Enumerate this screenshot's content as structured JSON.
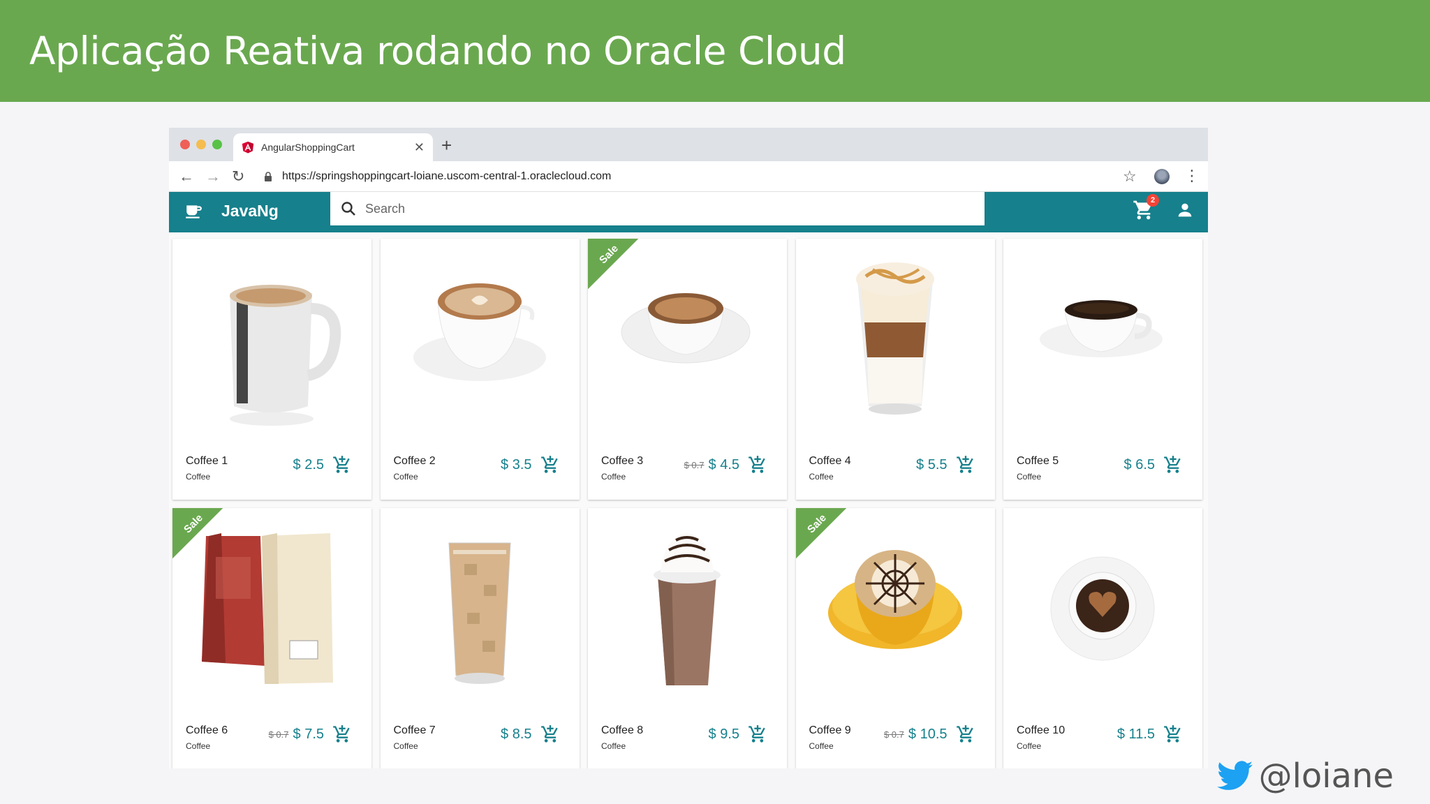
{
  "slide": {
    "title": "Aplicação Reativa rodando no Oracle Cloud",
    "twitter_handle": "@loiane"
  },
  "browser": {
    "tab_title": "AngularShoppingCart",
    "url": "https://springshoppingcart-loiane.uscom-central-1.oraclecloud.com"
  },
  "app": {
    "name": "JavaNg",
    "search_placeholder": "Search",
    "cart_count": "2",
    "accent_color": "#16808c",
    "sale_color": "#6aa84f"
  },
  "products": [
    {
      "name": "Coffee 1",
      "category": "Coffee",
      "old_price": "",
      "price": "$ 2.5",
      "sale": false,
      "image": "mug"
    },
    {
      "name": "Coffee 2",
      "category": "Coffee",
      "old_price": "",
      "price": "$ 3.5",
      "sale": false,
      "image": "latte-art-cup"
    },
    {
      "name": "Coffee 3",
      "category": "Coffee",
      "old_price": "$ 0.7",
      "price": "$ 4.5",
      "sale": true,
      "image": "espresso-cup"
    },
    {
      "name": "Coffee 4",
      "category": "Coffee",
      "old_price": "",
      "price": "$ 5.5",
      "sale": false,
      "image": "caramel-macchiato"
    },
    {
      "name": "Coffee 5",
      "category": "Coffee",
      "old_price": "",
      "price": "$ 6.5",
      "sale": false,
      "image": "black-coffee-cup"
    },
    {
      "name": "Coffee 6",
      "category": "Coffee",
      "old_price": "$ 0.7",
      "price": "$ 7.5",
      "sale": true,
      "image": "coffee-bags"
    },
    {
      "name": "Coffee 7",
      "category": "Coffee",
      "old_price": "",
      "price": "$ 8.5",
      "sale": false,
      "image": "iced-coffee"
    },
    {
      "name": "Coffee 8",
      "category": "Coffee",
      "old_price": "",
      "price": "$ 9.5",
      "sale": false,
      "image": "frappuccino"
    },
    {
      "name": "Coffee 9",
      "category": "Coffee",
      "old_price": "$ 0.7",
      "price": "$ 10.5",
      "sale": true,
      "image": "yellow-cup-latte"
    },
    {
      "name": "Coffee 10",
      "category": "Coffee",
      "old_price": "",
      "price": "$ 11.5",
      "sale": false,
      "image": "heart-coffee-top"
    }
  ],
  "sale_label": "Sale"
}
